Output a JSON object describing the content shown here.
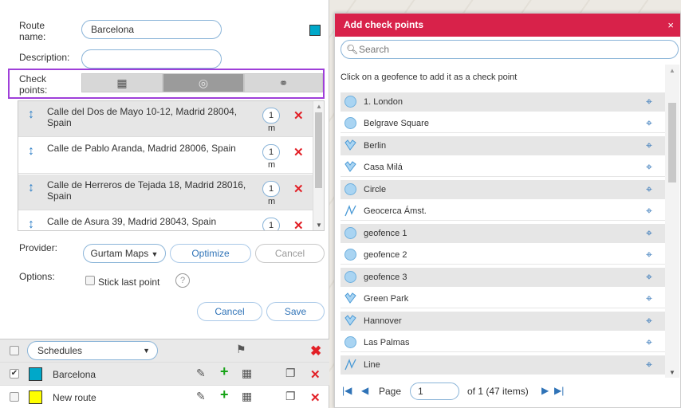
{
  "form": {
    "route_name_label": "Route\nname:",
    "route_name_value": "Barcelona",
    "route_color": "#00a8c9",
    "description_label": "Description:",
    "description_value": "",
    "check_points_label": "Check\npoints:",
    "tab_icons": [
      "table-icon",
      "geofence-icon",
      "link-icon"
    ],
    "addresses": [
      {
        "text": "Calle del Dos de Mayo 10-12, Madrid 28004, Spain",
        "radius": "1",
        "unit": "m"
      },
      {
        "text": "Calle de Pablo Aranda, Madrid 28006, Spain",
        "radius": "1",
        "unit": "m"
      },
      {
        "text": "Calle de Herreros de Tejada 18, Madrid 28016, Spain",
        "radius": "1",
        "unit": "m"
      },
      {
        "text": "Calle de Asura 39, Madrid 28043, Spain",
        "radius": "1",
        "unit": ""
      }
    ],
    "provider_label": "Provider:",
    "provider_value": "Gurtam Maps",
    "optimize_label": "Optimize",
    "cancel_small_label": "Cancel",
    "options_label": "Options:",
    "stick_last_point_label": "Stick last point",
    "cancel_label": "Cancel",
    "save_label": "Save"
  },
  "bottom": {
    "schedules_label": "Schedules",
    "routes": [
      {
        "name": "Barcelona",
        "color": "#00a8c9",
        "checked": true
      },
      {
        "name": "New route",
        "color": "#ffff00",
        "checked": false
      }
    ]
  },
  "dialog": {
    "title": "Add check points",
    "close": "×",
    "search_placeholder": "Search",
    "hint": "Click on a geofence to add it as a check point",
    "geofences": [
      {
        "name": "1. London",
        "icon": "circle"
      },
      {
        "name": "Belgrave Square",
        "icon": "circle"
      },
      {
        "name": "Berlin",
        "icon": "polygon"
      },
      {
        "name": "Casa Milá",
        "icon": "polygon"
      },
      {
        "name": "Circle",
        "icon": "circle"
      },
      {
        "name": "Geocerca Ámst.",
        "icon": "line"
      },
      {
        "name": "geofence 1",
        "icon": "circle"
      },
      {
        "name": "geofence 2",
        "icon": "circle"
      },
      {
        "name": "geofence 3",
        "icon": "circle"
      },
      {
        "name": "Green Park",
        "icon": "polygon"
      },
      {
        "name": "Hannover",
        "icon": "polygon"
      },
      {
        "name": "Las Palmas",
        "icon": "circle"
      },
      {
        "name": "Line",
        "icon": "line"
      }
    ],
    "pager": {
      "page_label": "Page",
      "page_value": "1",
      "of_text": "of 1 (47 items)"
    }
  }
}
